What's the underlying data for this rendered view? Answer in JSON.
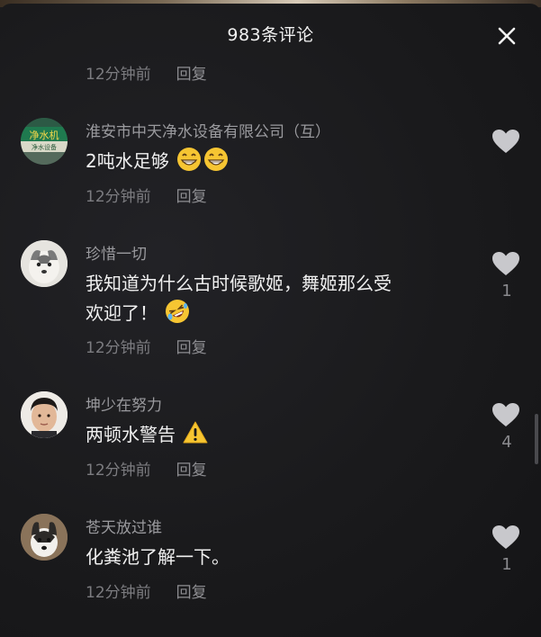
{
  "header": {
    "title": "983条评论"
  },
  "first_reply": {
    "time": "12分钟前",
    "reply_label": "回复"
  },
  "comments": [
    {
      "username": "淮安市中天净水设备有限公司（互）",
      "text": "2吨水足够",
      "emojis": [
        "grin-emoji",
        "grin-emoji"
      ],
      "time": "12分钟前",
      "reply_label": "回复",
      "likes": ""
    },
    {
      "username": "珍惜一切",
      "text_line1": "我知道为什么古时候歌姬，舞姬那么受",
      "text_line2": "欢迎了！",
      "emojis": [
        "rofl-emoji"
      ],
      "time": "12分钟前",
      "reply_label": "回复",
      "likes": "1"
    },
    {
      "username": "坤少在努力",
      "text": "两顿水警告",
      "emojis": [
        "warning-emoji"
      ],
      "time": "12分钟前",
      "reply_label": "回复",
      "likes": "4"
    },
    {
      "username": "苍天放过谁",
      "text": "化粪池了解一下。",
      "time": "12分钟前",
      "reply_label": "回复",
      "likes": "1"
    }
  ],
  "colors": {
    "background": "#1b1b1d",
    "text": "#f0f0f0",
    "muted": "#7c7c80",
    "heart": "#c8c8cc"
  },
  "avatar_sign": {
    "line1": "净水机",
    "line2": "净水设备"
  }
}
